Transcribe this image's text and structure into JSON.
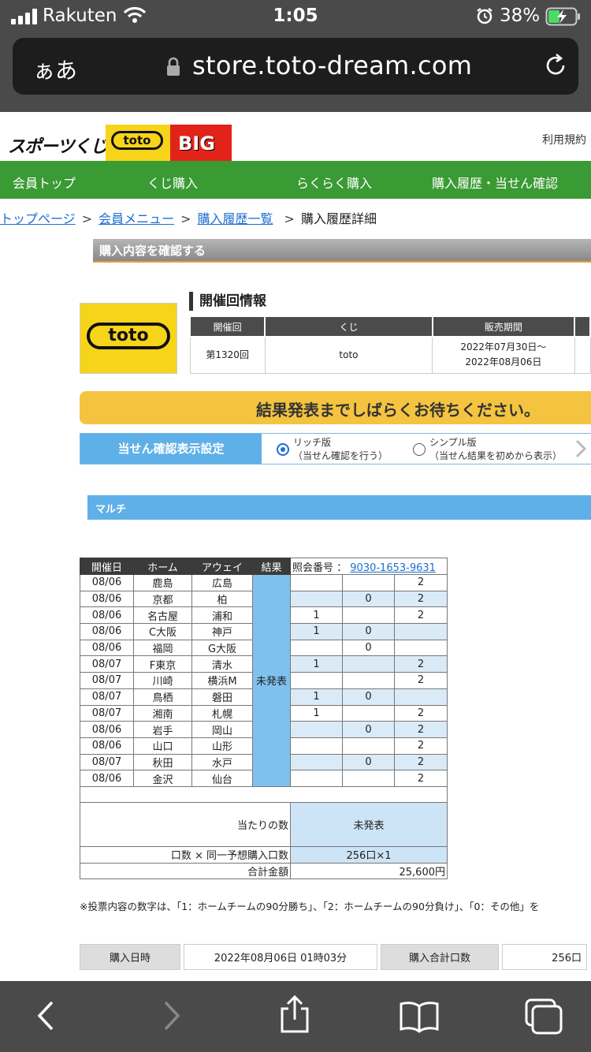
{
  "status_bar": {
    "carrier": "Rakuten",
    "time": "1:05",
    "battery": "38%"
  },
  "browser": {
    "aa_label": "ぁあ",
    "url": "store.toto-dream.com"
  },
  "header": {
    "logo_sports": "スポーツくじ",
    "logo_toto": "toto",
    "logo_big": "BIG",
    "terms": "利用規約"
  },
  "nav": [
    "会員トップ",
    "くじ購入",
    "らくらく購入",
    "購入履歴・当せん確認"
  ],
  "breadcrumb": {
    "top": "トップページ",
    "member": "会員メニュー",
    "history": "購入履歴一覧",
    "current": "購入履歴詳細",
    "sep": ">"
  },
  "section_title": "購入内容を確認する",
  "round_info": {
    "title": "開催回情報",
    "headers": [
      "開催回",
      "くじ",
      "販売期間"
    ],
    "round": "第1320回",
    "lottery": "toto",
    "period_start": "2022年07月30日〜",
    "period_end": "2022年08月06日"
  },
  "notice": "結果発表までしばらくお待ちください。",
  "display_setting": {
    "label": "当せん確認表示設定",
    "rich_title": "リッチ版",
    "rich_desc": "（当せん確認を行う）",
    "simple_title": "シンプル版",
    "simple_desc": "（当せん結果を初めから表示）"
  },
  "multi_label": "マルチ",
  "match_table": {
    "headers": {
      "date": "開催日",
      "home": "ホーム",
      "away": "アウェイ",
      "result": "結果",
      "ref_label": "照会番号 ：",
      "ref_number": "9030-1653-9631"
    },
    "result_text": "未発表",
    "rows": [
      {
        "date": "08/06",
        "home": "鹿島",
        "away": "広島",
        "p1": "",
        "p0": "",
        "p2": "2"
      },
      {
        "date": "08/06",
        "home": "京都",
        "away": "柏",
        "p1": "",
        "p0": "0",
        "p2": "2"
      },
      {
        "date": "08/06",
        "home": "名古屋",
        "away": "浦和",
        "p1": "1",
        "p0": "",
        "p2": "2"
      },
      {
        "date": "08/06",
        "home": "C大阪",
        "away": "神戸",
        "p1": "1",
        "p0": "0",
        "p2": ""
      },
      {
        "date": "08/06",
        "home": "福岡",
        "away": "G大阪",
        "p1": "",
        "p0": "0",
        "p2": ""
      },
      {
        "date": "08/07",
        "home": "F東京",
        "away": "清水",
        "p1": "1",
        "p0": "",
        "p2": "2"
      },
      {
        "date": "08/07",
        "home": "川崎",
        "away": "横浜M",
        "p1": "",
        "p0": "",
        "p2": "2"
      },
      {
        "date": "08/07",
        "home": "鳥栖",
        "away": "磐田",
        "p1": "1",
        "p0": "0",
        "p2": ""
      },
      {
        "date": "08/07",
        "home": "湘南",
        "away": "札幌",
        "p1": "1",
        "p0": "",
        "p2": "2"
      },
      {
        "date": "08/06",
        "home": "岩手",
        "away": "岡山",
        "p1": "",
        "p0": "0",
        "p2": "2"
      },
      {
        "date": "08/06",
        "home": "山口",
        "away": "山形",
        "p1": "",
        "p0": "",
        "p2": "2"
      },
      {
        "date": "08/07",
        "home": "秋田",
        "away": "水戸",
        "p1": "",
        "p0": "0",
        "p2": "2"
      },
      {
        "date": "08/06",
        "home": "金沢",
        "away": "仙台",
        "p1": "",
        "p0": "",
        "p2": "2"
      }
    ],
    "win_count_label": "当たりの数",
    "win_count_value": "未発表",
    "units_label": "口数 × 同一予想購入口数",
    "units_value": "256口×1",
    "total_label": "合計金額",
    "total_value": "25,600円"
  },
  "footnote": "※投票内容の数字は、「1：ホームチームの90分勝ち」、「2：ホームチームの90分負け」、「0：その他」を",
  "purchase_summary": {
    "date_label": "購入日時",
    "date_value": "2022年08月06日 01時03分",
    "units_label": "購入合計口数",
    "units_value": "256口"
  }
}
